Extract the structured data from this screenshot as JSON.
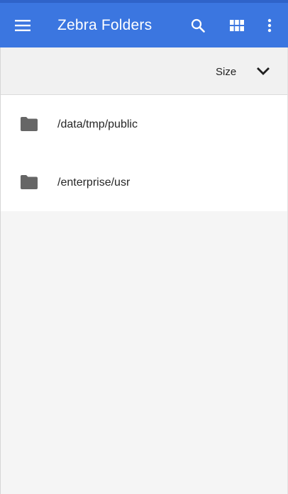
{
  "app": {
    "title": "Zebra Folders",
    "accent_color": "#3b76e0"
  },
  "toolbar": {
    "menu_icon": "hamburger-menu-icon",
    "search_icon": "search-icon",
    "view_icon": "grid-view-icon",
    "more_icon": "more-vert-icon"
  },
  "sort": {
    "label": "Size",
    "icon": "chevron-down-icon"
  },
  "folders": [
    {
      "path": "/data/tmp/public",
      "icon": "folder-icon"
    },
    {
      "path": "/enterprise/usr",
      "icon": "folder-icon"
    }
  ]
}
